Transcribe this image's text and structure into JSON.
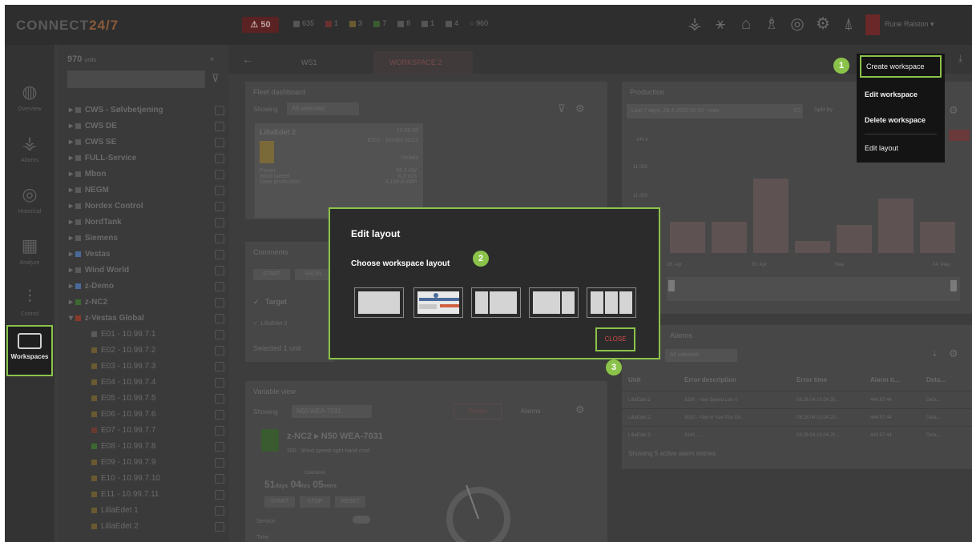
{
  "app": {
    "logo_main": "CONNECT",
    "logo_accent": "24/7"
  },
  "topbar": {
    "alarm_count": "50",
    "status_items": [
      "635",
      "1",
      "3",
      "7",
      "8",
      "1",
      "4",
      "960"
    ],
    "icons": [
      "wind-turbine-icon",
      "solar-icon",
      "building-icon",
      "tower-icon",
      "gauge-icon",
      "gear-icon",
      "pylon-icon"
    ],
    "user": "Rune Ralston ▾"
  },
  "leftnav": {
    "items": [
      {
        "label": "Overview",
        "icon": "globe-icon"
      },
      {
        "label": "Alarms",
        "icon": "turbine-icon"
      },
      {
        "label": "Historical",
        "icon": "history-icon"
      },
      {
        "label": "Analyze",
        "icon": "analyze-icon"
      },
      {
        "label": "Control",
        "icon": "control-icon"
      }
    ],
    "workspaces_label": "Workspaces"
  },
  "tree": {
    "count": "970",
    "count_unit": "units",
    "groups": [
      "CWS - Sølvbetjening",
      "CWS DE",
      "CWS SE",
      "FULL-Service",
      "Mbon",
      "NEGM",
      "Nordex Control",
      "NordTank",
      "Siemens",
      "Vestas",
      "Wind World",
      "z-Demo",
      "z-NC2",
      "z-Vestas Global"
    ],
    "units": [
      "E01 - 10.99.7.1",
      "E02 - 10.99.7.2",
      "E03 - 10.99.7.3",
      "E04 - 10.99.7.4",
      "E05 - 10.99.7.5",
      "E06 - 10.99.7.6",
      "E07 - 10.99.7.7",
      "E08 - 10.99.7.8",
      "E09 - 10.99.7.9",
      "E10 - 10.99.7.10",
      "E11 - 10.99.7.11",
      "LillaEdet 1",
      "LillaEdet 2"
    ]
  },
  "tabs": [
    "WS1",
    "WORKSPACE 2"
  ],
  "fleet": {
    "title": "Fleet dashboard",
    "showing_label": "Showing",
    "showing_value": "All selected",
    "unit_name": "LillaEdet 2",
    "unit_date": "10.05.06",
    "unit_model": "E201 · Nordex N117",
    "details": "Details",
    "metrics": [
      {
        "k": "Power",
        "v": "95,4 kW"
      },
      {
        "k": "Wind speed",
        "v": "6,3 m/s"
      },
      {
        "k": "Daily production",
        "v": "4.158,8 kWh"
      }
    ]
  },
  "comments": {
    "title": "Comments",
    "start": "START",
    "show": "SHOW",
    "target": "Target",
    "row": "LillaEdet 2",
    "selected": "Selected 1 unit"
  },
  "unit_view": {
    "title": "Variable view",
    "showing_label": "Showing",
    "showing_value": "N50 WEA-7031",
    "tabs": [
      "Details",
      "Alarms"
    ],
    "path": "z-NC2 ▸ N50 WEA-7031",
    "status": "300 · Wind speed right hand cmd",
    "op_time_label": "Operation",
    "days": "51",
    "hrs": "04",
    "mins": "05",
    "days_unit": "days",
    "hrs_unit": "hrs",
    "mins_unit": "mins",
    "buttons": [
      "START",
      "STOP",
      "RESET"
    ],
    "service_label": "Service",
    "time_label": "Time"
  },
  "production": {
    "title": "Production",
    "range": "Last 7 days: 28.4.2020 00.00 - now",
    "split_label": "Split by",
    "ylabels": [
      "140 k",
      "11 000",
      "11 000"
    ],
    "xlabels": [
      "28. Apr",
      "30. Apr",
      "May",
      "04. May"
    ],
    "bars": [
      0.26,
      0.26,
      0.62,
      0.1,
      0.23,
      0.45,
      0.26
    ]
  },
  "alarms": {
    "title": "Alarms",
    "filter_value": "All selected",
    "columns": [
      "Unit",
      "Error description",
      "Error time",
      "Alarm ti...",
      "Deta..."
    ],
    "rows": [
      [
        "LillaEdet 2",
        "3230 - Yaw Speed Low 0",
        "08.28.04 10.04.20...",
        "444:57:44",
        "Deta..."
      ],
      [
        "LillaEdet 2",
        "3032 - Yaw In Yaw Pos Err...",
        "08.28.04 10.04.20...",
        "444:57:44",
        "Deta..."
      ],
      [
        "LillaEdet 2",
        "3140 - ...",
        "08.28.04 10.04.20...",
        "444:57:44",
        "Deta..."
      ]
    ],
    "footer": "Showing 5 active alarm entries"
  },
  "workspace_menu": {
    "create": "Create workspace",
    "edit": "Edit workspace",
    "delete": "Delete workspace",
    "layout": "Edit layout"
  },
  "modal": {
    "title": "Edit layout",
    "subtitle": "Choose workspace layout",
    "close": "CLOSE",
    "options": [
      "single",
      "current",
      "split-2",
      "split-3-mid",
      "split-3"
    ]
  },
  "callouts": [
    "1",
    "2",
    "3"
  ],
  "colors": {
    "accent": "#8bc34a",
    "close": "#d04a4a",
    "menu_bg": "#141414",
    "modal_bg": "#2b2b2b"
  }
}
